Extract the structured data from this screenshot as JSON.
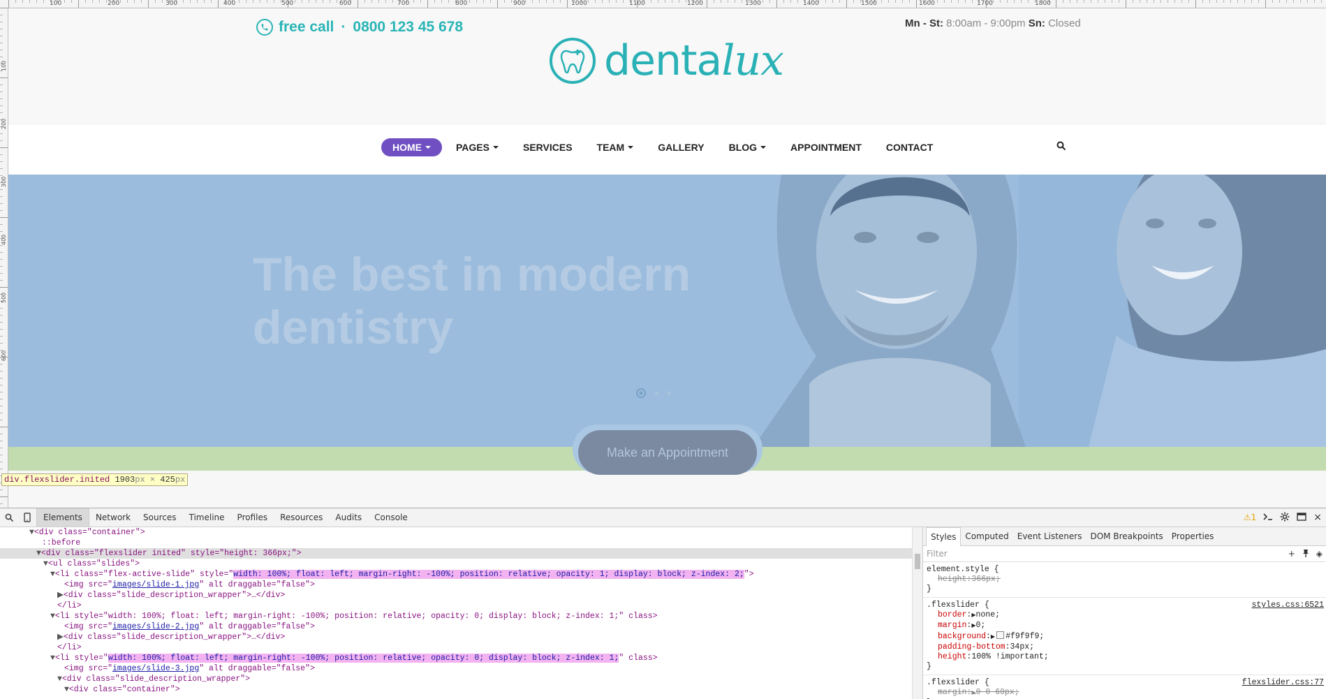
{
  "rulers": {
    "top_labels": [
      "100",
      "200",
      "300",
      "400",
      "500",
      "600",
      "700",
      "800",
      "900",
      "1000",
      "1100",
      "1200",
      "1300",
      "1400",
      "1500",
      "1600",
      "1700",
      "1800"
    ],
    "left_labels": [
      "100",
      "200",
      "300",
      "400",
      "500",
      "600"
    ]
  },
  "site": {
    "phone": {
      "prefix": "free call",
      "separator": "·",
      "number": "0800 123 45 678"
    },
    "hours": {
      "weekday_label": "Mn - St:",
      "weekday_value": "8:00am - 9:00pm",
      "sunday_label": "Sn:",
      "sunday_value": "Closed"
    },
    "logo": {
      "text_regular": "denta",
      "text_script": "lux"
    },
    "nav": [
      {
        "label": "HOME",
        "dropdown": true,
        "active": true
      },
      {
        "label": "PAGES",
        "dropdown": true
      },
      {
        "label": "SERVICES",
        "dropdown": false
      },
      {
        "label": "TEAM",
        "dropdown": true
      },
      {
        "label": "GALLERY",
        "dropdown": false
      },
      {
        "label": "BLOG",
        "dropdown": true
      },
      {
        "label": "APPOINTMENT",
        "dropdown": false
      },
      {
        "label": "CONTACT",
        "dropdown": false
      }
    ],
    "slider": {
      "title_line1": "The best in modern",
      "title_line2": "dentistry",
      "cta_label": "Make an Appointment",
      "slide_count": 3,
      "active_slide": 1
    },
    "colors": {
      "brand": "#2ab1b6",
      "nav_active": "#6f4fc2",
      "overlay": "#9bbcdd",
      "highlight_green": "#c2dcb0"
    }
  },
  "inspector_tooltip": {
    "selector": "div.flexslider.inited",
    "width_value": "1903",
    "height_value": "425",
    "unit": "px",
    "times": "×"
  },
  "devtools": {
    "tabs": [
      "Elements",
      "Network",
      "Sources",
      "Timeline",
      "Profiles",
      "Resources",
      "Audits",
      "Console"
    ],
    "active_tab": "Elements",
    "warning_count": "1",
    "dom_lines": {
      "l1": "<div class=\"container\">",
      "l2": "::before",
      "l3_tag": "<div class=\"flexslider inited\" style=\"height: 366px;\">",
      "l4": "<ul class=\"slides\">",
      "l5_open": "<li class=\"flex-active-slide\" style=\"",
      "l5_style": "width: 100%; float: left; margin-right: -100%; position: relative; opacity: 1; display: block; z-index: 2;",
      "l5_close": "\">",
      "l6_pre": "<img src=\"",
      "l6_src": "images/slide-1.jpg",
      "l6_post": "\" alt draggable=\"false\">",
      "l7": "<div class=\"slide_description_wrapper\">…</div>",
      "l8": "</li>",
      "l9": "<li style=\"width: 100%; float: left; margin-right: -100%; position: relative; opacity: 0; display: block; z-index: 1;\" class>",
      "l10_src": "images/slide-2.jpg",
      "l11": "<div class=\"slide_description_wrapper\">…</div>",
      "l12": "</li>",
      "l13_open": "<li style=\"",
      "l13_style": "width: 100%; float: left; margin-right: -100%; position: relative; opacity: 0; display: block; z-index: 1;",
      "l13_close": "\" class>",
      "l14_src": "images/slide-3.jpg",
      "l15": "<div class=\"slide_description_wrapper\">",
      "l16": "<div class=\"container\">"
    },
    "styles_panel": {
      "tabs": [
        "Styles",
        "Computed",
        "Event Listeners",
        "DOM Breakpoints",
        "Properties"
      ],
      "active_tab": "Styles",
      "filter_placeholder": "Filter",
      "rules": [
        {
          "selector": "element.style {",
          "source": "",
          "props": [
            {
              "name": "height",
              "value": "366px;",
              "struck": true
            }
          ]
        },
        {
          "selector": ".flexslider {",
          "source": "styles.css:6521",
          "props": [
            {
              "name": "border",
              "value": "none;",
              "arrow": true
            },
            {
              "name": "margin",
              "value": "0;",
              "arrow": true
            },
            {
              "name": "background",
              "value": "#f9f9f9;",
              "arrow": true,
              "swatch": "#f9f9f9"
            },
            {
              "name": "padding-bottom",
              "value": "34px;"
            },
            {
              "name": "height",
              "value": "100% !important;"
            }
          ]
        },
        {
          "selector": ".flexslider {",
          "source": "flexslider.css:77",
          "props": [
            {
              "name": "margin",
              "value": "0 0 60px;",
              "struck": true,
              "arrow": true
            }
          ]
        }
      ],
      "close_brace": "}"
    }
  }
}
